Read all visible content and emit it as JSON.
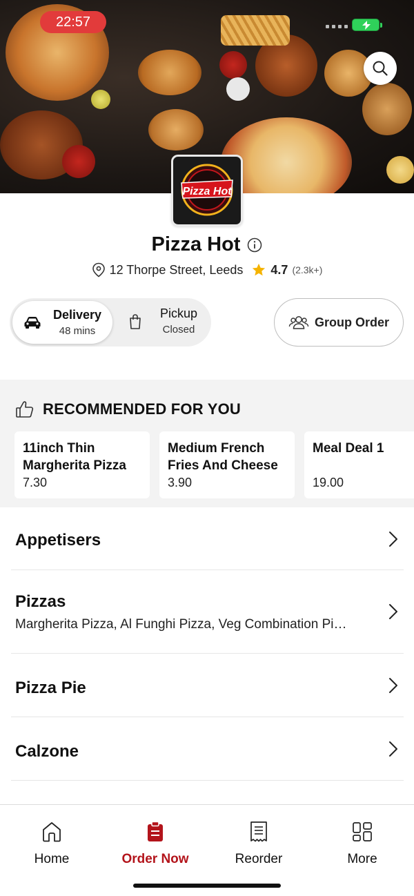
{
  "status_bar": {
    "time": "22:57"
  },
  "restaurant": {
    "logo_text": "Pizza Hot",
    "name": "Pizza Hot",
    "address": "12 Thorpe Street, Leeds",
    "rating": "4.7",
    "rating_count": "(2.3k+)"
  },
  "order_mode": {
    "delivery_label": "Delivery",
    "delivery_time": "48 mins",
    "pickup_label": "Pickup",
    "pickup_status": "Closed",
    "group_order_label": "Group Order"
  },
  "recommended": {
    "heading": "RECOMMENDED FOR YOU",
    "items": [
      {
        "name": "11inch Thin Margherita Pizza",
        "price": "7.30"
      },
      {
        "name": "Medium French Fries And Cheese",
        "price": "3.90"
      },
      {
        "name": "Meal Deal 1",
        "price": "19.00"
      }
    ]
  },
  "categories": [
    {
      "name": "Appetisers",
      "description": ""
    },
    {
      "name": "Pizzas",
      "description": "Margherita Pizza, Al Funghi Pizza, Veg Combination Pi…"
    },
    {
      "name": "Pizza Pie",
      "description": ""
    },
    {
      "name": "Calzone",
      "description": ""
    }
  ],
  "nav": {
    "items": [
      {
        "label": "Home",
        "icon": "home-icon"
      },
      {
        "label": "Order Now",
        "icon": "order-icon"
      },
      {
        "label": "Reorder",
        "icon": "receipt-icon"
      },
      {
        "label": "More",
        "icon": "grid-icon"
      }
    ],
    "active_index": 1
  },
  "colors": {
    "accent": "#b3141b",
    "status_pill": "#e23b3b",
    "star": "#f5b301"
  }
}
